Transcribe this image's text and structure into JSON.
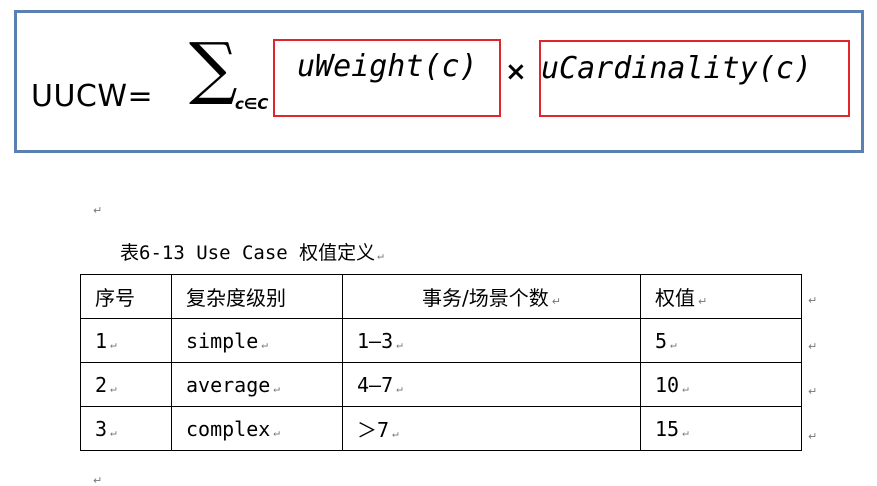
{
  "formula": {
    "label": "UUCW=",
    "sigma": "∑",
    "sigma_subscript": "c∈C",
    "term1": "uWeight(c)",
    "operator": "×",
    "term2": "uCardinality(c)",
    "accent_color": "#e0252c",
    "border_color": "#5b80b2"
  },
  "paragraph_mark": "↵",
  "caption": "表6-13 Use Case 权值定义",
  "table": {
    "headers": [
      "序号",
      "复杂度级别",
      "事务/场景个数",
      "权值"
    ],
    "rows": [
      [
        "1",
        "simple",
        "1—3",
        "5"
      ],
      [
        "2",
        "average",
        "4—7",
        "10"
      ],
      [
        "3",
        "complex",
        "＞7",
        "15"
      ]
    ]
  }
}
